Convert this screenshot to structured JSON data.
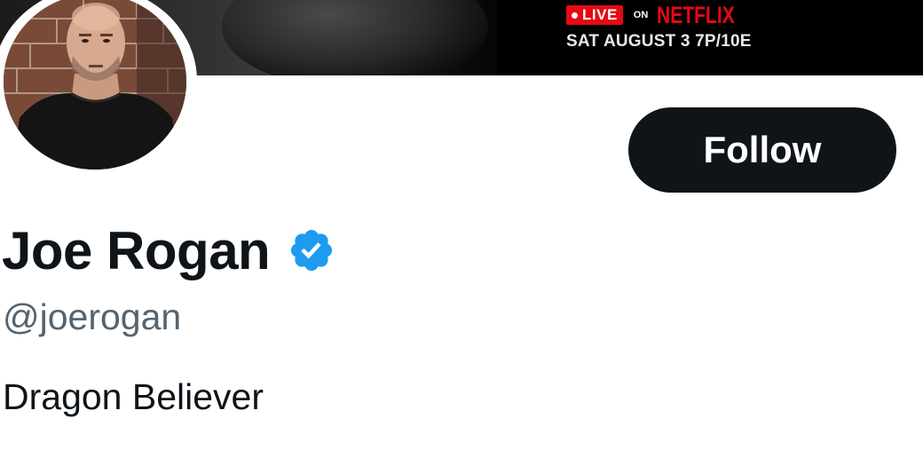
{
  "banner": {
    "live_label": "LIVE",
    "on_label": "ON",
    "network": "NETFLIX",
    "air_date": "SAT AUGUST 3 7P/10E"
  },
  "profile": {
    "display_name": "Joe Rogan",
    "handle": "@joerogan",
    "bio": "Dragon Believer",
    "verified": true
  },
  "actions": {
    "follow_label": "Follow"
  },
  "icons": {
    "verified": "verified-badge-icon"
  },
  "colors": {
    "follow_bg": "#0f1419",
    "verified_blue": "#1d9bf0",
    "netflix_red": "#e50914",
    "handle_gray": "#536471"
  }
}
